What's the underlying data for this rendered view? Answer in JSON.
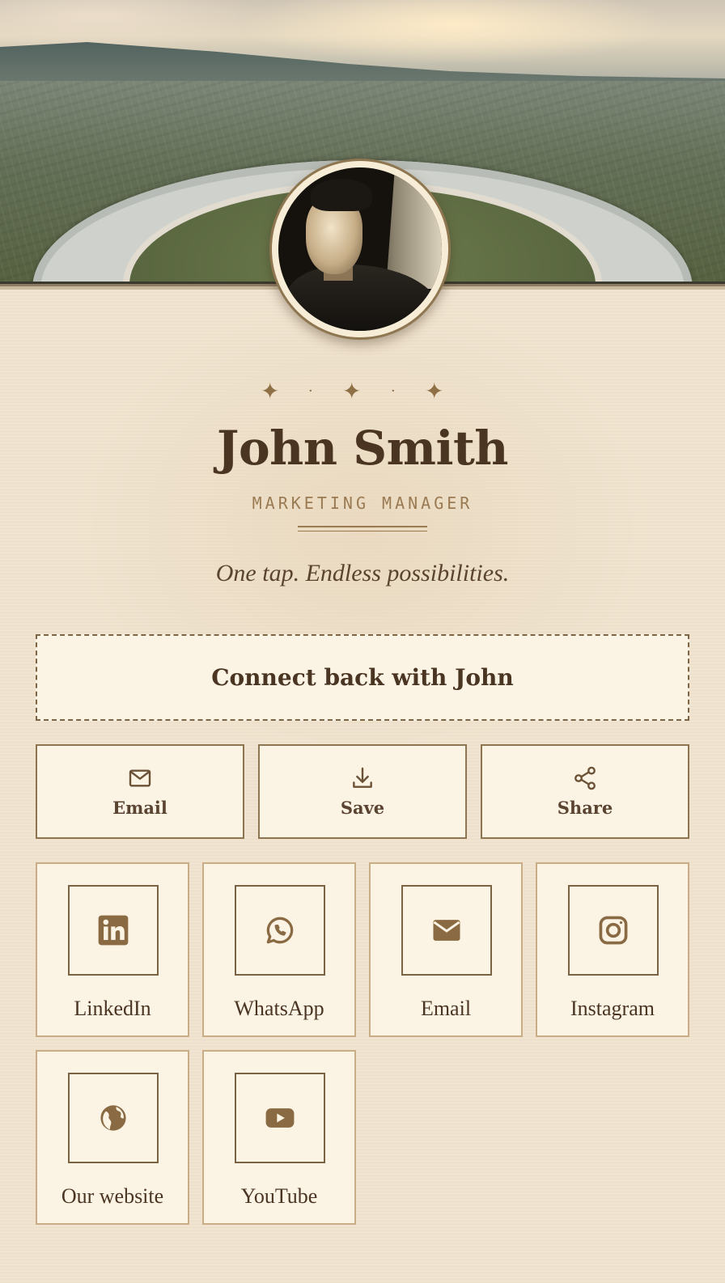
{
  "profile": {
    "name": "John Smith",
    "title": "MARKETING MANAGER",
    "tagline": "One tap. Endless possibilities."
  },
  "ornament": {
    "star": "✦",
    "dot": "·"
  },
  "connect": {
    "label": "Connect back with John"
  },
  "actions": [
    {
      "label": "Email",
      "icon": "mail-outline-icon"
    },
    {
      "label": "Save",
      "icon": "download-icon"
    },
    {
      "label": "Share",
      "icon": "share-icon"
    }
  ],
  "links": [
    {
      "label": "LinkedIn",
      "icon": "linkedin-icon"
    },
    {
      "label": "WhatsApp",
      "icon": "whatsapp-icon"
    },
    {
      "label": "Email",
      "icon": "envelope-icon"
    },
    {
      "label": "Instagram",
      "icon": "instagram-icon"
    },
    {
      "label": "Our website",
      "icon": "globe-icon"
    },
    {
      "label": "YouTube",
      "icon": "youtube-icon"
    }
  ],
  "colors": {
    "background": "#f0e4d0",
    "accent": "#8f6f45",
    "text": "#4a3522",
    "card": "#fbf3e4"
  }
}
